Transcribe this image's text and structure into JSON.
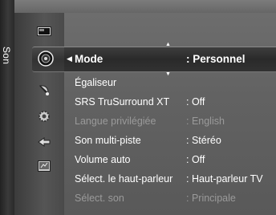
{
  "section": "Son",
  "sidebar_icons": [
    "picture-icon",
    "sound-icon",
    "channel-icon",
    "settings-icon",
    "input-icon",
    "application-icon"
  ],
  "menu": {
    "rows": [
      {
        "label": "Mode",
        "value": ": Personnel",
        "state": "selected"
      },
      {
        "label": "Égaliseur",
        "value": "",
        "state": "normal"
      },
      {
        "label": "SRS TruSurround XT",
        "value": ": Off",
        "state": "normal"
      },
      {
        "label": "Langue privilégiée",
        "value": ": English",
        "state": "disabled"
      },
      {
        "label": "Son multi-piste",
        "value": ": Stéréo",
        "state": "normal"
      },
      {
        "label": "Volume auto",
        "value": ": Off",
        "state": "normal"
      },
      {
        "label": "Sélect. le haut-parleur",
        "value": ": Haut-parleur TV",
        "state": "normal"
      },
      {
        "label": "Sélect. son",
        "value": ": Principale",
        "state": "disabled"
      }
    ]
  },
  "colors": {
    "highlight": "#2e2e2e",
    "text": "#ffffff",
    "disabled_text": "#9a9a9a"
  }
}
